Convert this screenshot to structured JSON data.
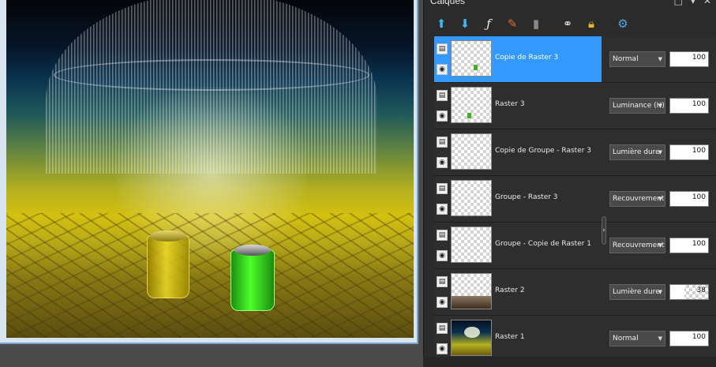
{
  "panel": {
    "title": "Calques",
    "controls": [
      "□",
      "▾",
      "✕"
    ]
  },
  "toolbar": {
    "icons": [
      "move-layer-up-icon",
      "move-layer-down-icon",
      "layer-effects-icon",
      "brush-icon",
      "document-icon",
      "link-icon",
      "lock-icon",
      "gear-icon"
    ]
  },
  "layers": [
    {
      "name": "Copie de Raster 3",
      "blend_mode": "Normal",
      "opacity": 100,
      "selected": true,
      "thumbnail": "transparent-with-spot"
    },
    {
      "name": "Raster 3",
      "blend_mode": "Luminance (H)",
      "opacity": 100,
      "selected": false,
      "thumbnail": "transparent-with-spot"
    },
    {
      "name": "Copie de Groupe - Raster 3",
      "blend_mode": "Lumière dure",
      "opacity": 100,
      "selected": false,
      "thumbnail": "transparent"
    },
    {
      "name": "Groupe - Raster 3",
      "blend_mode": "Recouvrement",
      "opacity": 100,
      "selected": false,
      "thumbnail": "transparent"
    },
    {
      "name": "Groupe - Copie de Raster 1",
      "blend_mode": "Recouvrement",
      "opacity": 100,
      "selected": false,
      "thumbnail": "transparent"
    },
    {
      "name": "Raster 2",
      "blend_mode": "Lumière dure",
      "opacity": 38,
      "selected": false,
      "thumbnail": "bottom-texture"
    },
    {
      "name": "Raster 1",
      "blend_mode": "Normal",
      "opacity": 100,
      "selected": false,
      "thumbnail": "full-image"
    }
  ],
  "colors": {
    "selection": "#3399ff",
    "panel_bg": "#2b2b2b"
  }
}
